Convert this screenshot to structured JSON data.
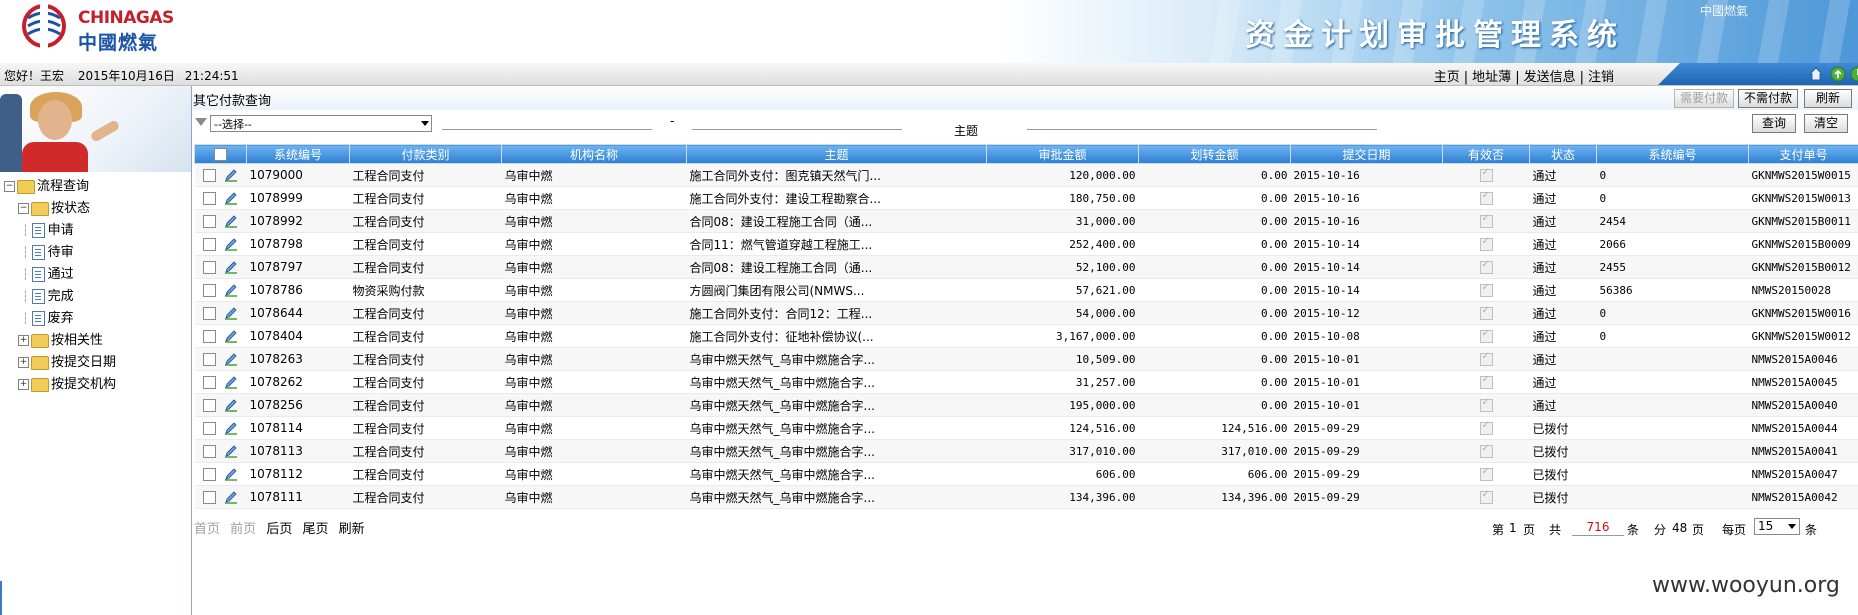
{
  "header": {
    "logo_en": "CHINAGAS",
    "logo_cn": "中國燃氣",
    "system_title": "资金计划审批管理系统",
    "banner_mark": "中國燃氣"
  },
  "userbar": {
    "greeting": "您好！王宏",
    "date": "2015年10月16日",
    "time": "21:24:51",
    "links": [
      "主页",
      "地址薄",
      "发送信息",
      "注销"
    ],
    "separator": "|",
    "icons": [
      "home-icon",
      "refresh-icon",
      "exit-icon"
    ]
  },
  "sidebar": {
    "tree": {
      "root": "流程查询",
      "by_status": "按状态",
      "status_items": [
        "申请",
        "待审",
        "通过",
        "完成",
        "废弃"
      ],
      "others": [
        "按相关性",
        "按提交日期",
        "按提交机构"
      ]
    }
  },
  "main": {
    "page_title": "其它付款查询",
    "buttons": {
      "need_pay": "需要付款",
      "no_pay": "不需付款",
      "refresh": "刷新",
      "query": "查询",
      "clear": "清空"
    },
    "filter": {
      "select_value": "--选择--",
      "dash": "-",
      "subject_label": "主题"
    },
    "table": {
      "columns": [
        "",
        "系统编号",
        "付款类别",
        "机构名称",
        "主题",
        "审批金额",
        "划转金额",
        "提交日期",
        "有效否",
        "状态",
        "系统编号",
        "支付单号"
      ],
      "rows": [
        {
          "id": "1079000",
          "type": "工程合同支付",
          "org": "乌审中燃",
          "subject": "施工合同外支付：图克镇天然气门...",
          "approved": "120,000.00",
          "transfer": "0.00",
          "date": "2015-10-16",
          "status": "通过",
          "sys2": "0",
          "pay_no": "GKNMWS2015W0015"
        },
        {
          "id": "1078999",
          "type": "工程合同支付",
          "org": "乌审中燃",
          "subject": "施工合同外支付：建设工程勘察合...",
          "approved": "180,750.00",
          "transfer": "0.00",
          "date": "2015-10-16",
          "status": "通过",
          "sys2": "0",
          "pay_no": "GKNMWS2015W0013"
        },
        {
          "id": "1078992",
          "type": "工程合同支付",
          "org": "乌审中燃",
          "subject": "合同08：建设工程施工合同（通...",
          "approved": "31,000.00",
          "transfer": "0.00",
          "date": "2015-10-16",
          "status": "通过",
          "sys2": "2454",
          "pay_no": "GKNMWS2015B0011"
        },
        {
          "id": "1078798",
          "type": "工程合同支付",
          "org": "乌审中燃",
          "subject": "合同11：燃气管道穿越工程施工...",
          "approved": "252,400.00",
          "transfer": "0.00",
          "date": "2015-10-14",
          "status": "通过",
          "sys2": "2066",
          "pay_no": "GKNMWS2015B0009"
        },
        {
          "id": "1078797",
          "type": "工程合同支付",
          "org": "乌审中燃",
          "subject": "合同08：建设工程施工合同（通...",
          "approved": "52,100.00",
          "transfer": "0.00",
          "date": "2015-10-14",
          "status": "通过",
          "sys2": "2455",
          "pay_no": "GKNMWS2015B0012"
        },
        {
          "id": "1078786",
          "type": "物资采购付款",
          "org": "乌审中燃",
          "subject": "方圆阀门集团有限公司(NMWS...",
          "approved": "57,621.00",
          "transfer": "0.00",
          "date": "2015-10-14",
          "status": "通过",
          "sys2": "56386",
          "pay_no": "NMWS20150028"
        },
        {
          "id": "1078644",
          "type": "工程合同支付",
          "org": "乌审中燃",
          "subject": "施工合同外支付：合同12：工程...",
          "approved": "54,000.00",
          "transfer": "0.00",
          "date": "2015-10-12",
          "status": "通过",
          "sys2": "0",
          "pay_no": "GKNMWS2015W0016"
        },
        {
          "id": "1078404",
          "type": "工程合同支付",
          "org": "乌审中燃",
          "subject": "施工合同外支付：征地补偿协议(...",
          "approved": "3,167,000.00",
          "transfer": "0.00",
          "date": "2015-10-08",
          "status": "通过",
          "sys2": "0",
          "pay_no": "GKNMWS2015W0012"
        },
        {
          "id": "1078263",
          "type": "工程合同支付",
          "org": "乌审中燃",
          "subject": "乌审中燃天然气_乌审中燃施合字...",
          "approved": "10,509.00",
          "transfer": "0.00",
          "date": "2015-10-01",
          "status": "通过",
          "sys2": "",
          "pay_no": "NMWS2015A0046"
        },
        {
          "id": "1078262",
          "type": "工程合同支付",
          "org": "乌审中燃",
          "subject": "乌审中燃天然气_乌审中燃施合字...",
          "approved": "31,257.00",
          "transfer": "0.00",
          "date": "2015-10-01",
          "status": "通过",
          "sys2": "",
          "pay_no": "NMWS2015A0045"
        },
        {
          "id": "1078256",
          "type": "工程合同支付",
          "org": "乌审中燃",
          "subject": "乌审中燃天然气_乌审中燃施合字...",
          "approved": "195,000.00",
          "transfer": "0.00",
          "date": "2015-10-01",
          "status": "通过",
          "sys2": "",
          "pay_no": "NMWS2015A0040"
        },
        {
          "id": "1078114",
          "type": "工程合同支付",
          "org": "乌审中燃",
          "subject": "乌审中燃天然气_乌审中燃施合字...",
          "approved": "124,516.00",
          "transfer": "124,516.00",
          "date": "2015-09-29",
          "status": "已拨付",
          "sys2": "",
          "pay_no": "NMWS2015A0044"
        },
        {
          "id": "1078113",
          "type": "工程合同支付",
          "org": "乌审中燃",
          "subject": "乌审中燃天然气_乌审中燃施合字...",
          "approved": "317,010.00",
          "transfer": "317,010.00",
          "date": "2015-09-29",
          "status": "已拨付",
          "sys2": "",
          "pay_no": "NMWS2015A0041"
        },
        {
          "id": "1078112",
          "type": "工程合同支付",
          "org": "乌审中燃",
          "subject": "乌审中燃天然气_乌审中燃施合字...",
          "approved": "606.00",
          "transfer": "606.00",
          "date": "2015-09-29",
          "status": "已拨付",
          "sys2": "",
          "pay_no": "NMWS2015A0047"
        },
        {
          "id": "1078111",
          "type": "工程合同支付",
          "org": "乌审中燃",
          "subject": "乌审中燃天然气_乌审中燃施合字...",
          "approved": "134,396.00",
          "transfer": "134,396.00",
          "date": "2015-09-29",
          "status": "已拨付",
          "sys2": "",
          "pay_no": "NMWS2015A0042"
        }
      ]
    },
    "pager": {
      "first": "首页",
      "prev": "前页",
      "next": "后页",
      "last": "尾页",
      "refresh": "刷新",
      "page_prefix": "第",
      "page_number": "1",
      "page_suffix": "页",
      "total_prefix": "共",
      "total": "716",
      "total_suffix": "条",
      "pages_prefix": "分",
      "pages": "48",
      "pages_suffix": "页",
      "per_page_prefix": "每页",
      "per_page": "15",
      "per_page_suffix": "条"
    }
  },
  "watermark": "www.wooyun.org",
  "colors": {
    "header_blue": "#2c7fd3",
    "total_red": "#d01010",
    "logo_red": "#c51f2b",
    "logo_blue": "#1c55a6"
  }
}
